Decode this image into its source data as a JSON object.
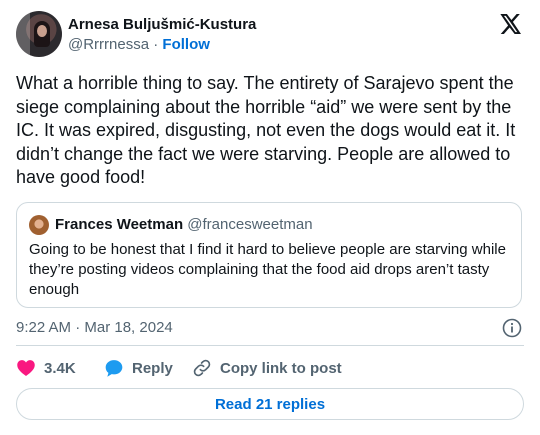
{
  "author": {
    "name": "Arnesa Buljušmić-Kustura",
    "handle": "@Rrrrnessa",
    "separator": "·",
    "follow_label": "Follow"
  },
  "brand_icon": "x-logo-icon",
  "tweet": {
    "text": "What a horrible thing to say. The entirety of Sarajevo spent the siege complaining about the horrible “aid” we were sent by the IC. It was expired, disgusting, not even the dogs would eat it. It didn’t change the fact we were starving. People are allowed to have good food!"
  },
  "quoted": {
    "name": "Frances Weetman",
    "handle": "@francesweetman",
    "text": "Going to be honest that I find it hard to believe people are starving while they’re posting videos complaining that the food aid drops aren’t tasty enough"
  },
  "timestamp": "9:22 AM · Mar 18, 2024",
  "actions": {
    "likes_count": "3.4K",
    "reply_label": "Reply",
    "copy_label": "Copy link to post"
  },
  "read_replies_label": "Read 21 replies",
  "colors": {
    "link": "#006fd6",
    "like": "#f91880",
    "reply_icon": "#1d9bf0",
    "border": "#cfd9de",
    "secondary_text": "#536471"
  }
}
